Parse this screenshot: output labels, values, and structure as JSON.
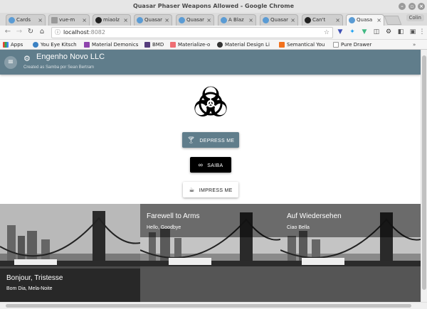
{
  "window": {
    "title": "Quasar Phaser Weapons Allowed - Google Chrome"
  },
  "tabs": [
    {
      "label": "Cards"
    },
    {
      "label": "vue-m"
    },
    {
      "label": "miaolz"
    },
    {
      "label": "Quasar"
    },
    {
      "label": "Quasar"
    },
    {
      "label": "A Blaz"
    },
    {
      "label": "Quasar"
    },
    {
      "label": "Can't"
    },
    {
      "label": "Quasa"
    }
  ],
  "profile": "Colin",
  "address": {
    "host": "localhost",
    "port": ":8082"
  },
  "bookmarks": [
    {
      "label": "Apps",
      "color": "#e94235"
    },
    {
      "label": "You Eye Kitsch",
      "color": "#3b82c4"
    },
    {
      "label": "Material Demonics",
      "color": "#8e44ad"
    },
    {
      "label": "BMD",
      "color": "#563d7c"
    },
    {
      "label": "Materialize-o",
      "color": "#ee6e73"
    },
    {
      "label": "Material Design Li",
      "color": "#333333"
    },
    {
      "label": "Semantical You",
      "color": "#f2711c"
    },
    {
      "label": "Pure Drawer",
      "color": "#dddddd"
    }
  ],
  "app": {
    "title": "Engenho Novo LLC",
    "subtitle": "Created as Samba por Sean Bertram",
    "accent": "#607d8b"
  },
  "buttons": {
    "depress": "Depress Me",
    "samba": "Saiba",
    "impress": "Impress Me"
  },
  "cards": [
    {
      "title": "Bonjour, Tristesse",
      "subtitle": "Bom Dia, Mela-Noite"
    },
    {
      "title": "Farewell to Arms",
      "subtitle": "Hello, Goodbye"
    },
    {
      "title": "Auf Wiedersehen",
      "subtitle": "Ciao Bella"
    }
  ]
}
